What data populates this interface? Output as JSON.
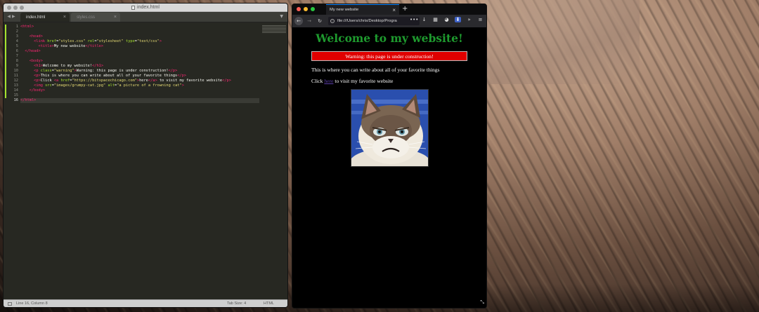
{
  "editor": {
    "window_title": "index.html",
    "tabs": [
      {
        "label": "index.html",
        "active": true
      },
      {
        "label": "styles.css",
        "active": false
      }
    ],
    "line_numbers": [
      "1",
      "2",
      "3",
      "4",
      "5",
      "6",
      "7",
      "8",
      "9",
      "10",
      "11",
      "12",
      "13",
      "14",
      "15",
      "16"
    ],
    "code_lines": [
      [
        {
          "c": "tag",
          "t": "<html>"
        }
      ],
      [],
      [
        {
          "c": "txt",
          "t": "    "
        },
        {
          "c": "tag",
          "t": "<head>"
        }
      ],
      [
        {
          "c": "txt",
          "t": "      "
        },
        {
          "c": "tag",
          "t": "<link"
        },
        {
          "c": "txt",
          "t": " "
        },
        {
          "c": "attr",
          "t": "href"
        },
        {
          "c": "txt",
          "t": "="
        },
        {
          "c": "str",
          "t": "\"styles.css\""
        },
        {
          "c": "txt",
          "t": " "
        },
        {
          "c": "attr",
          "t": "rel"
        },
        {
          "c": "txt",
          "t": "="
        },
        {
          "c": "str",
          "t": "\"stylesheet\""
        },
        {
          "c": "txt",
          "t": " "
        },
        {
          "c": "attr",
          "t": "type"
        },
        {
          "c": "txt",
          "t": "="
        },
        {
          "c": "str",
          "t": "\"text/css\""
        },
        {
          "c": "tag",
          "t": ">"
        }
      ],
      [
        {
          "c": "txt",
          "t": "        "
        },
        {
          "c": "tag",
          "t": "<title>"
        },
        {
          "c": "txt",
          "t": "My new website"
        },
        {
          "c": "tag",
          "t": "</title>"
        }
      ],
      [
        {
          "c": "txt",
          "t": "  "
        },
        {
          "c": "tag",
          "t": "</head>"
        }
      ],
      [],
      [
        {
          "c": "txt",
          "t": "    "
        },
        {
          "c": "tag",
          "t": "<body>"
        }
      ],
      [
        {
          "c": "txt",
          "t": "      "
        },
        {
          "c": "tag",
          "t": "<h1>"
        },
        {
          "c": "txt",
          "t": "Welcome to my website!"
        },
        {
          "c": "tag",
          "t": "</h1>"
        }
      ],
      [
        {
          "c": "txt",
          "t": "      "
        },
        {
          "c": "tag",
          "t": "<p"
        },
        {
          "c": "txt",
          "t": " "
        },
        {
          "c": "attr",
          "t": "class"
        },
        {
          "c": "txt",
          "t": "="
        },
        {
          "c": "str",
          "t": "\"warning\""
        },
        {
          "c": "tag",
          "t": ">"
        },
        {
          "c": "txt",
          "t": "Warning: this page is under construction!"
        },
        {
          "c": "tag",
          "t": "</p>"
        }
      ],
      [
        {
          "c": "txt",
          "t": "      "
        },
        {
          "c": "tag",
          "t": "<p>"
        },
        {
          "c": "txt",
          "t": "This is where you can write about all of your favorite things"
        },
        {
          "c": "tag",
          "t": "</p>"
        }
      ],
      [
        {
          "c": "txt",
          "t": "      "
        },
        {
          "c": "tag",
          "t": "<p>"
        },
        {
          "c": "txt",
          "t": "Click "
        },
        {
          "c": "tag",
          "t": "<a"
        },
        {
          "c": "txt",
          "t": " "
        },
        {
          "c": "attr",
          "t": "href"
        },
        {
          "c": "txt",
          "t": "="
        },
        {
          "c": "str",
          "t": "\"https://bitspacechicago.com\""
        },
        {
          "c": "tag",
          "t": ">"
        },
        {
          "c": "txt",
          "t": "here"
        },
        {
          "c": "tag",
          "t": "</a>"
        },
        {
          "c": "txt",
          "t": " to visit my favorite website"
        },
        {
          "c": "tag",
          "t": "</p>"
        }
      ],
      [
        {
          "c": "txt",
          "t": "      "
        },
        {
          "c": "tag",
          "t": "<img"
        },
        {
          "c": "txt",
          "t": " "
        },
        {
          "c": "attr",
          "t": "src"
        },
        {
          "c": "txt",
          "t": "="
        },
        {
          "c": "str",
          "t": "\"images/grumpy-cat.jpg\""
        },
        {
          "c": "txt",
          "t": " "
        },
        {
          "c": "attr",
          "t": "alt"
        },
        {
          "c": "txt",
          "t": "="
        },
        {
          "c": "str",
          "t": "\"a picture of a frowning cat\""
        },
        {
          "c": "tag",
          "t": ">"
        }
      ],
      [
        {
          "c": "txt",
          "t": "    "
        },
        {
          "c": "tag",
          "t": "</body>"
        }
      ],
      [],
      [
        {
          "c": "tag",
          "t": "</html>"
        }
      ]
    ],
    "current_line": 16,
    "status": {
      "position": "Line 16, Column 8",
      "tab_size": "Tab Size: 4",
      "syntax": "HTML"
    }
  },
  "browser": {
    "tab_title": "My new website",
    "url": "file:///Users/chris/Desktop/Progra",
    "page": {
      "heading": "Welcome to my website!",
      "warning": "Warning: this page is under construction!",
      "paragraph1": "This is where you can write about all of your favorite things",
      "paragraph2_before": "Click ",
      "link_text": "here",
      "paragraph2_after": " to visit my favorite website"
    }
  },
  "colors": {
    "heading": "#1e9a2e",
    "warning_bg": "#e00000",
    "link": "#5a3ea8"
  }
}
